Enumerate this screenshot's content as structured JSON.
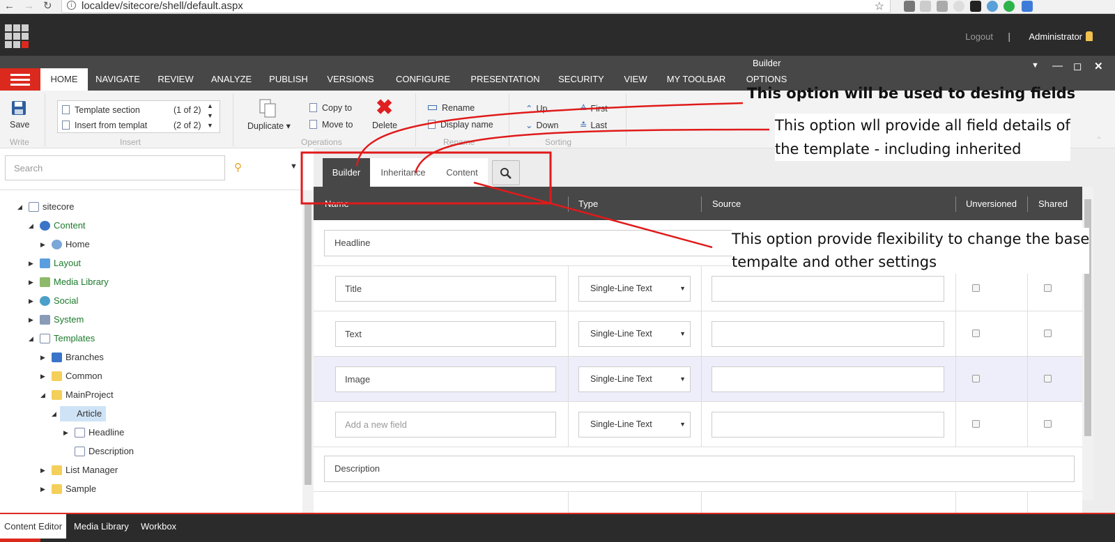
{
  "browser": {
    "url": "localdev/sitecore/shell/default.aspx"
  },
  "topbar": {
    "logout": "Logout",
    "separator": "|",
    "user": "Administrator"
  },
  "window": {
    "title": "Builder"
  },
  "ribbon_tabs": [
    "HOME",
    "NAVIGATE",
    "REVIEW",
    "ANALYZE",
    "PUBLISH",
    "VERSIONS",
    "CONFIGURE",
    "PRESENTATION",
    "SECURITY",
    "VIEW",
    "MY TOOLBAR",
    "OPTIONS"
  ],
  "ribbon": {
    "save": "Save",
    "group_write": "Write",
    "insert_items": [
      {
        "label": "Template section",
        "count": "(1 of 2)"
      },
      {
        "label": "Insert from templat",
        "count": "(2 of 2)"
      }
    ],
    "group_insert": "Insert",
    "duplicate": "Duplicate",
    "copy_to": "Copy to",
    "move_to": "Move to",
    "delete": "Delete",
    "group_operations": "Operations",
    "rename": "Rename",
    "display_name": "Display name",
    "group_rename": "Rename",
    "up": "Up",
    "down": "Down",
    "first": "First",
    "last": "Last",
    "group_sorting": "Sorting"
  },
  "search": {
    "placeholder": "Search"
  },
  "tree": [
    {
      "label": "sitecore",
      "state": "expanded",
      "icon": "doc-icon",
      "green": false
    },
    {
      "label": "Content",
      "state": "expanded",
      "icon": "content-icon",
      "green": true
    },
    {
      "label": "Home",
      "state": "collapsed",
      "icon": "home-icon",
      "green": false
    },
    {
      "label": "Layout",
      "state": "collapsed",
      "icon": "layout-icon",
      "green": true
    },
    {
      "label": "Media Library",
      "state": "collapsed",
      "icon": "media-icon",
      "green": true
    },
    {
      "label": "Social",
      "state": "collapsed",
      "icon": "social-icon",
      "green": true
    },
    {
      "label": "System",
      "state": "collapsed",
      "icon": "system-icon",
      "green": true
    },
    {
      "label": "Templates",
      "state": "expanded",
      "icon": "templates-icon",
      "green": true
    },
    {
      "label": "Branches",
      "state": "collapsed",
      "icon": "branches-icon",
      "green": false
    },
    {
      "label": "Common",
      "state": "collapsed",
      "icon": "folder-icon",
      "green": false
    },
    {
      "label": "MainProject",
      "state": "expanded",
      "icon": "folder-icon",
      "green": false
    },
    {
      "label": "Article",
      "state": "expanded",
      "icon": "template-icon",
      "green": false,
      "selected": true
    },
    {
      "label": "Headline",
      "state": "collapsed",
      "icon": "section-icon",
      "green": false
    },
    {
      "label": "Description",
      "state": "none",
      "icon": "section-icon",
      "green": false
    },
    {
      "label": "List Manager",
      "state": "collapsed",
      "icon": "folder-icon",
      "green": false
    },
    {
      "label": "Sample",
      "state": "collapsed",
      "icon": "folder-icon",
      "green": false
    }
  ],
  "builder_tabs": {
    "builder": "Builder",
    "inheritance": "Inheritance",
    "content": "Content"
  },
  "grid": {
    "headers": {
      "name": "Name",
      "type": "Type",
      "source": "Source",
      "unversioned": "Unversioned",
      "shared": "Shared"
    },
    "sections": [
      {
        "name": "Headline",
        "fields": [
          {
            "name": "Title",
            "type": "Single-Line Text"
          },
          {
            "name": "Text",
            "type": "Single-Line Text"
          },
          {
            "name": "Image",
            "type": "Single-Line Text",
            "highlighted": true
          },
          {
            "name": "",
            "placeholder": "Add a new field",
            "type": "Single-Line Text"
          }
        ]
      },
      {
        "name": "Description"
      }
    ]
  },
  "bottom_tabs": [
    "Content Editor",
    "Media Library",
    "Workbox"
  ],
  "annotations": {
    "a1": "This option will be used to desing fields",
    "a2_line1": "This option wll provide all field details of",
    "a2_line2": "the template - including inherited",
    "a3_line1": "This option provide flexibility to change the base",
    "a3_line2": "tempalte and other settings"
  },
  "colors": {
    "accent_red": "#dc291e",
    "dark_bar": "#2b2b2b",
    "ribbon_tabs_bg": "#474747",
    "tree_green": "#1b7a2a"
  }
}
